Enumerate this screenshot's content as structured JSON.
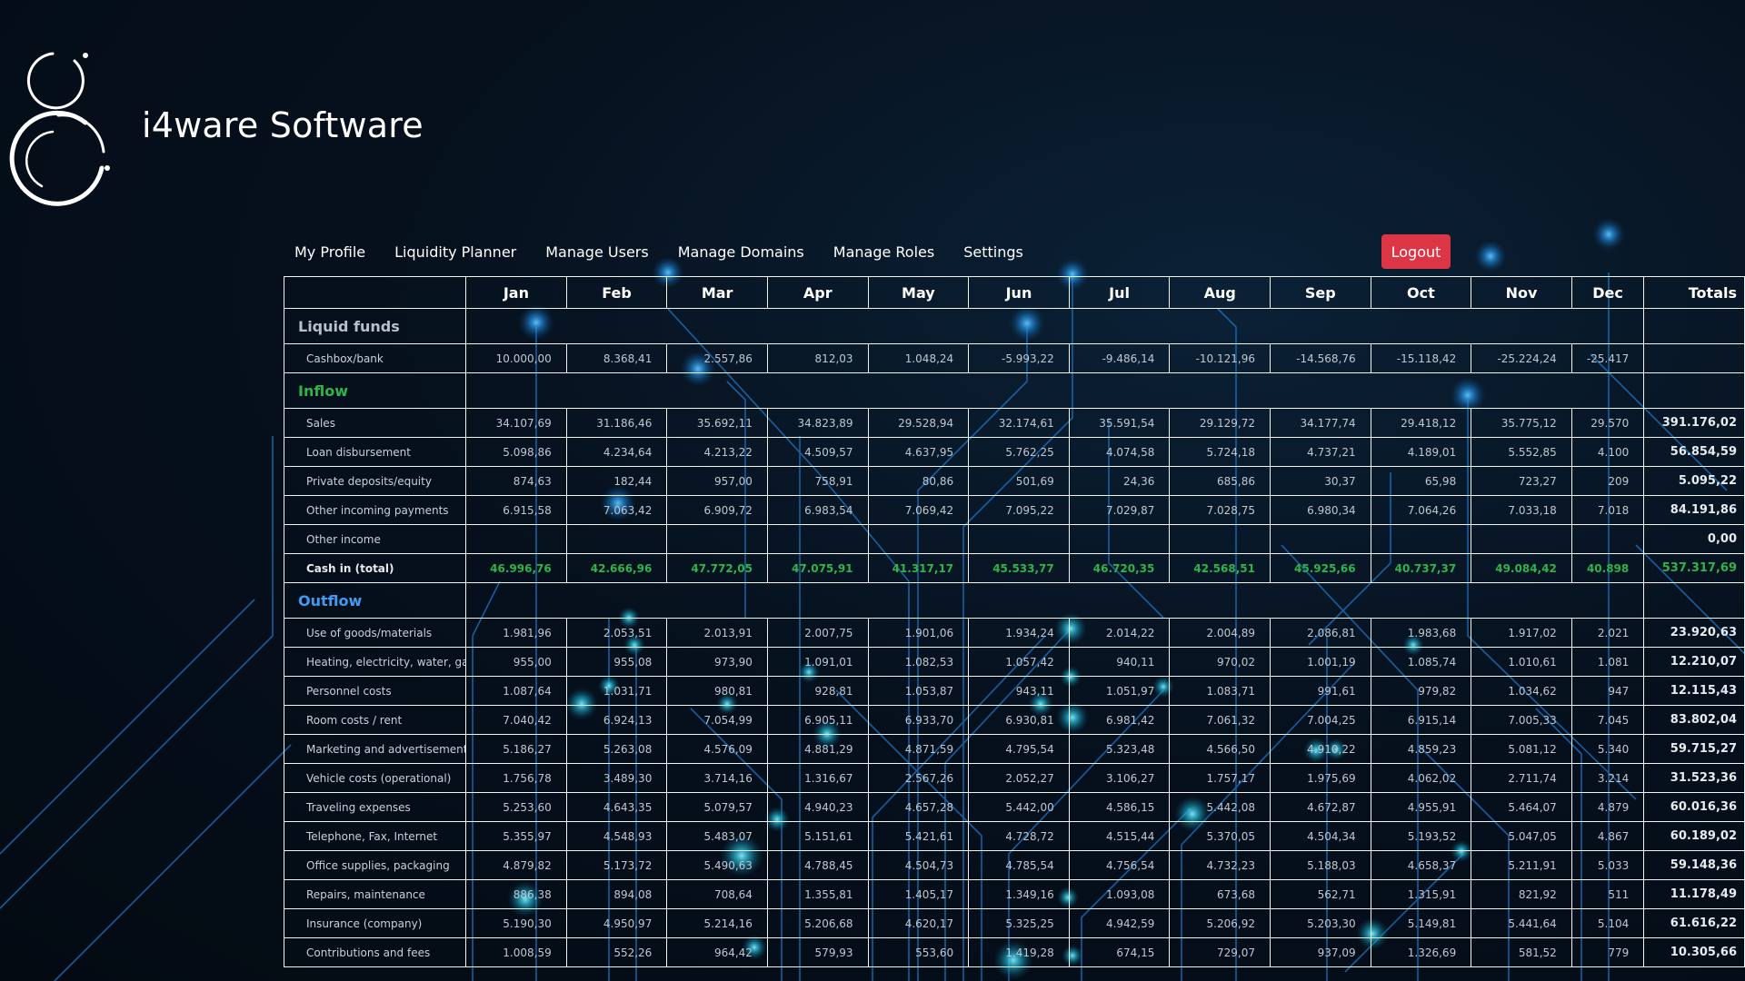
{
  "brand": {
    "name": "i4ware Software"
  },
  "nav": {
    "items": [
      "My Profile",
      "Liquidity Planner",
      "Manage Users",
      "Manage Domains",
      "Manage Roles",
      "Settings"
    ],
    "logout_label": "Logout"
  },
  "colors": {
    "logout": "#dc3545",
    "inflow": "#2fb34a",
    "outflow": "#3f9cf2",
    "liquid": "#b8c0c8"
  },
  "table": {
    "months": [
      "Jan",
      "Feb",
      "Mar",
      "Apr",
      "May",
      "Jun",
      "Jul",
      "Aug",
      "Sep",
      "Oct",
      "Nov",
      "Dec"
    ],
    "totals_label": "Totals",
    "sections": [
      {
        "title": "Liquid funds",
        "color": "#b8c0c8",
        "rows": [
          {
            "label": "Cashbox/bank",
            "values": [
              "10.000,00",
              "8.368,41",
              "2.557,86",
              "812,03",
              "1.048,24",
              "-5.993,22",
              "-9.486,14",
              "-10.121,96",
              "-14.568,76",
              "-15.118,42",
              "-25.224,24",
              "-25.417"
            ],
            "total": ""
          }
        ]
      },
      {
        "title": "Inflow",
        "color": "#2fb34a",
        "rows": [
          {
            "label": "Sales",
            "values": [
              "34.107,69",
              "31.186,46",
              "35.692,11",
              "34.823,89",
              "29.528,94",
              "32.174,61",
              "35.591,54",
              "29.129,72",
              "34.177,74",
              "29.418,12",
              "35.775,12",
              "29.570"
            ],
            "total": "391.176,02"
          },
          {
            "label": "Loan disbursement",
            "values": [
              "5.098,86",
              "4.234,64",
              "4.213,22",
              "4.509,57",
              "4.637,95",
              "5.762,25",
              "4.074,58",
              "5.724,18",
              "4.737,21",
              "4.189,01",
              "5.552,85",
              "4.100"
            ],
            "total": "56.854,59"
          },
          {
            "label": "Private deposits/equity",
            "values": [
              "874,63",
              "182,44",
              "957,00",
              "758,91",
              "80,86",
              "501,69",
              "24,36",
              "685,86",
              "30,37",
              "65,98",
              "723,27",
              "209"
            ],
            "total": "5.095,22"
          },
          {
            "label": "Other incoming payments",
            "values": [
              "6.915,58",
              "7.063,42",
              "6.909,72",
              "6.983,54",
              "7.069,42",
              "7.095,22",
              "7.029,87",
              "7.028,75",
              "6.980,34",
              "7.064,26",
              "7.033,18",
              "7.018"
            ],
            "total": "84.191,86"
          },
          {
            "label": "Other income",
            "values": [
              "",
              "",
              "",
              "",
              "",
              "",
              "",
              "",
              "",
              "",
              "",
              ""
            ],
            "total": "0,00"
          },
          {
            "label": "Cash in (total)",
            "values": [
              "46.996,76",
              "42.666,96",
              "47.772,05",
              "47.075,91",
              "41.317,17",
              "45.533,77",
              "46.720,35",
              "42.568,51",
              "45.925,66",
              "40.737,37",
              "49.084,42",
              "40.898"
            ],
            "total": "537.317,69",
            "highlight": true
          }
        ]
      },
      {
        "title": "Outflow",
        "color": "#3f9cf2",
        "rows": [
          {
            "label": "Use of goods/materials",
            "values": [
              "1.981,96",
              "2.053,51",
              "2.013,91",
              "2.007,75",
              "1.901,06",
              "1.934,24",
              "2.014,22",
              "2.004,89",
              "2.086,81",
              "1.983,68",
              "1.917,02",
              "2.021"
            ],
            "total": "23.920,63"
          },
          {
            "label": "Heating, electricity, water, gas",
            "values": [
              "955,00",
              "955,08",
              "973,90",
              "1.091,01",
              "1.082,53",
              "1.057,42",
              "940,11",
              "970,02",
              "1.001,19",
              "1.085,74",
              "1.010,61",
              "1.081"
            ],
            "total": "12.210,07"
          },
          {
            "label": "Personnel costs",
            "values": [
              "1.087,64",
              "1.031,71",
              "980,81",
              "928,81",
              "1.053,87",
              "943,11",
              "1.051,97",
              "1.083,71",
              "991,61",
              "979,82",
              "1.034,62",
              "947"
            ],
            "total": "12.115,43"
          },
          {
            "label": "Room costs / rent",
            "values": [
              "7.040,42",
              "6.924,13",
              "7.054,99",
              "6.905,11",
              "6.933,70",
              "6.930,81",
              "6.981,42",
              "7.061,32",
              "7.004,25",
              "6.915,14",
              "7.005,33",
              "7.045"
            ],
            "total": "83.802,04"
          },
          {
            "label": "Marketing and advertisement",
            "values": [
              "5.186,27",
              "5.263,08",
              "4.576,09",
              "4.881,29",
              "4.871,59",
              "4.795,54",
              "5.323,48",
              "4.566,50",
              "4.910,22",
              "4.859,23",
              "5.081,12",
              "5.340"
            ],
            "total": "59.715,27"
          },
          {
            "label": "Vehicle costs (operational)",
            "values": [
              "1.756,78",
              "3.489,30",
              "3.714,16",
              "1.316,67",
              "2.567,26",
              "2.052,27",
              "3.106,27",
              "1.757,17",
              "1.975,69",
              "4.062,02",
              "2.711,74",
              "3.214"
            ],
            "total": "31.523,36"
          },
          {
            "label": "Traveling expenses",
            "values": [
              "5.253,60",
              "4.643,35",
              "5.079,57",
              "4.940,23",
              "4.657,28",
              "5.442,00",
              "4.586,15",
              "5.442,08",
              "4.672,87",
              "4.955,91",
              "5.464,07",
              "4.879"
            ],
            "total": "60.016,36"
          },
          {
            "label": "Telephone, Fax, Internet",
            "values": [
              "5.355,97",
              "4.548,93",
              "5.483,07",
              "5.151,61",
              "5.421,61",
              "4.728,72",
              "4.515,44",
              "5.370,05",
              "4.504,34",
              "5.193,52",
              "5.047,05",
              "4.867"
            ],
            "total": "60.189,02"
          },
          {
            "label": "Office supplies, packaging",
            "values": [
              "4.879,82",
              "5.173,72",
              "5.490,63",
              "4.788,45",
              "4.504,73",
              "4.785,54",
              "4.756,54",
              "4.732,23",
              "5.188,03",
              "4.658,37",
              "5.211,91",
              "5.033"
            ],
            "total": "59.148,36"
          },
          {
            "label": "Repairs, maintenance",
            "values": [
              "886,38",
              "894,08",
              "708,64",
              "1.355,81",
              "1.405,17",
              "1.349,16",
              "1.093,08",
              "673,68",
              "562,71",
              "1.315,91",
              "821,92",
              "511"
            ],
            "total": "11.178,49"
          },
          {
            "label": "Insurance (company)",
            "values": [
              "5.190,30",
              "4.950,97",
              "5.214,16",
              "5.206,68",
              "4.620,17",
              "5.325,25",
              "4.942,59",
              "5.206,92",
              "5.203,30",
              "5.149,81",
              "5.441,64",
              "5.104"
            ],
            "total": "61.616,22"
          },
          {
            "label": "Contributions and fees",
            "values": [
              "1.008,59",
              "552,26",
              "964,42",
              "579,93",
              "553,60",
              "1.419,28",
              "674,15",
              "729,07",
              "937,09",
              "1.326,69",
              "581,52",
              "779"
            ],
            "total": "10.305,66"
          }
        ]
      }
    ]
  }
}
